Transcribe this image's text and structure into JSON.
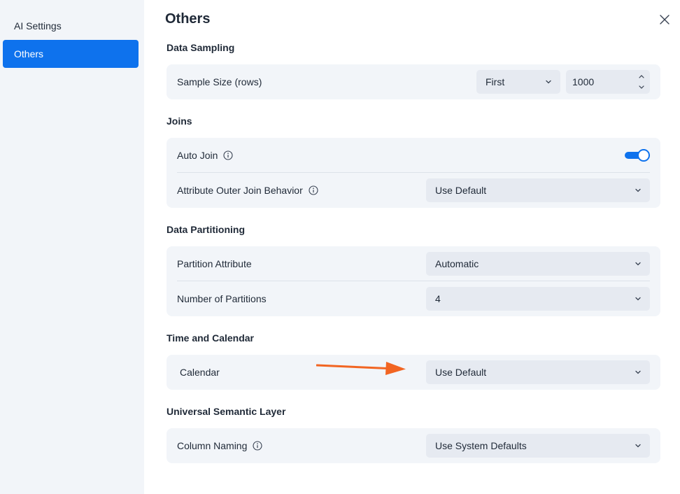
{
  "sidebar": {
    "items": [
      {
        "label": "AI Settings",
        "active": false
      },
      {
        "label": "Others",
        "active": true
      }
    ]
  },
  "page": {
    "title": "Others",
    "close_icon": "close-icon"
  },
  "sections": {
    "data_sampling": {
      "title": "Data Sampling",
      "sample_size": {
        "label": "Sample Size (rows)",
        "mode": "First",
        "value": "1000"
      }
    },
    "joins": {
      "title": "Joins",
      "auto_join": {
        "label": "Auto Join",
        "enabled": true
      },
      "outer_join": {
        "label": "Attribute Outer Join Behavior",
        "value": "Use Default"
      }
    },
    "data_partitioning": {
      "title": "Data Partitioning",
      "partition_attribute": {
        "label": "Partition Attribute",
        "value": "Automatic"
      },
      "number_of_partitions": {
        "label": "Number of Partitions",
        "value": "4"
      }
    },
    "time_calendar": {
      "title": "Time and Calendar",
      "calendar": {
        "label": "Calendar",
        "value": "Use Default"
      }
    },
    "semantic_layer": {
      "title": "Universal Semantic Layer",
      "column_naming": {
        "label": "Column Naming",
        "value": "Use System Defaults"
      }
    }
  },
  "colors": {
    "accent": "#0e72ed",
    "sidebar_bg": "#f2f5f9",
    "card_bg": "#f2f5f9",
    "field_bg": "#e6eaf1",
    "annotation_arrow": "#f26522"
  }
}
